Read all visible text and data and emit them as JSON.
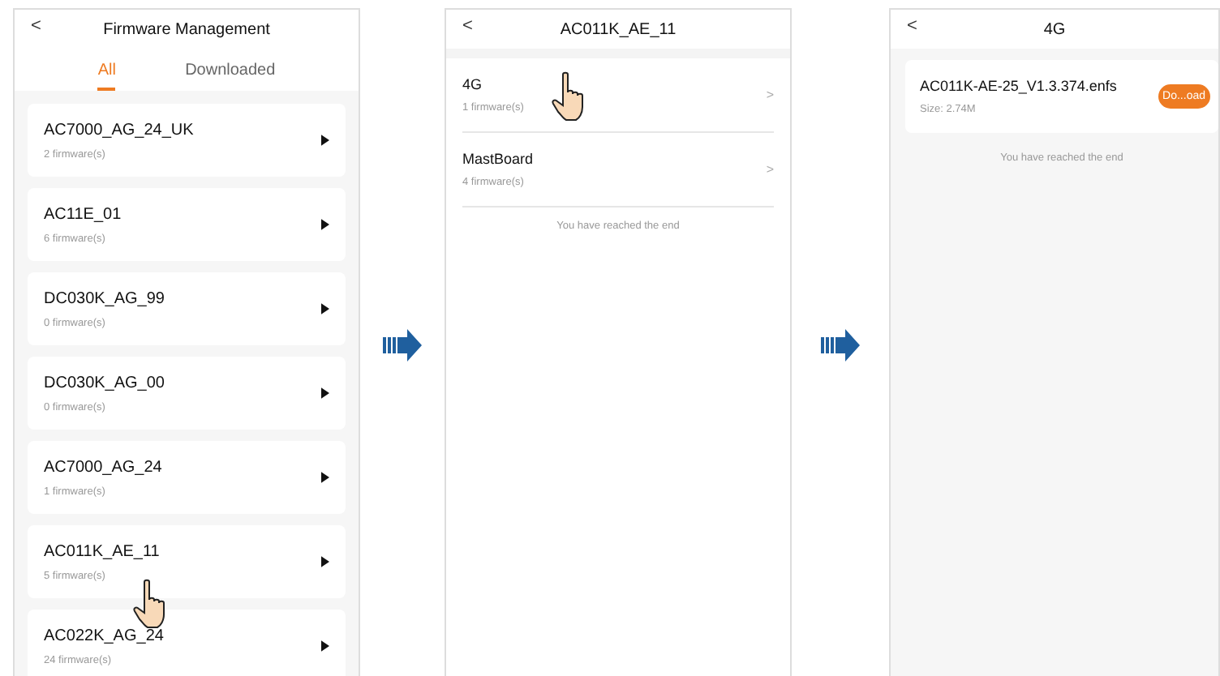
{
  "firmware_management": {
    "title": "Firmware Management",
    "back": "<",
    "tabs": [
      {
        "label": "All",
        "selected": true
      },
      {
        "label": "Downloaded",
        "selected": false
      }
    ],
    "items": [
      {
        "name": "AC7000_AG_24_UK",
        "count": "2 firmware(s)",
        "pointer": false
      },
      {
        "name": "AC11E_01",
        "count": "6 firmware(s)",
        "pointer": false
      },
      {
        "name": "DC030K_AG_99",
        "count": "0 firmware(s)",
        "pointer": false
      },
      {
        "name": "DC030K_AG_00",
        "count": "0 firmware(s)",
        "pointer": false
      },
      {
        "name": "AC7000_AG_24",
        "count": "1 firmware(s)",
        "pointer": false
      },
      {
        "name": "AC011K_AE_11",
        "count": "5 firmware(s)",
        "pointer": true
      },
      {
        "name": "AC022K_AG_24",
        "count": "24 firmware(s)",
        "pointer": false
      }
    ]
  },
  "model_screen": {
    "title": "AC011K_AE_11",
    "back": "<",
    "items": [
      {
        "name": "4G",
        "count": "1 firmware(s)",
        "chevron": ">",
        "pointer": true
      },
      {
        "name": "MastBoard",
        "count": "4 firmware(s)",
        "chevron": ">",
        "pointer": false
      }
    ],
    "end_note": "You have reached the end"
  },
  "module_screen": {
    "title": "4G",
    "back": "<",
    "files": [
      {
        "name": "AC011K-AE-25_V1.3.374.enfs",
        "size": "Size: 2.74M",
        "button": "Do...oad"
      }
    ],
    "end_note": "You have reached the end"
  }
}
